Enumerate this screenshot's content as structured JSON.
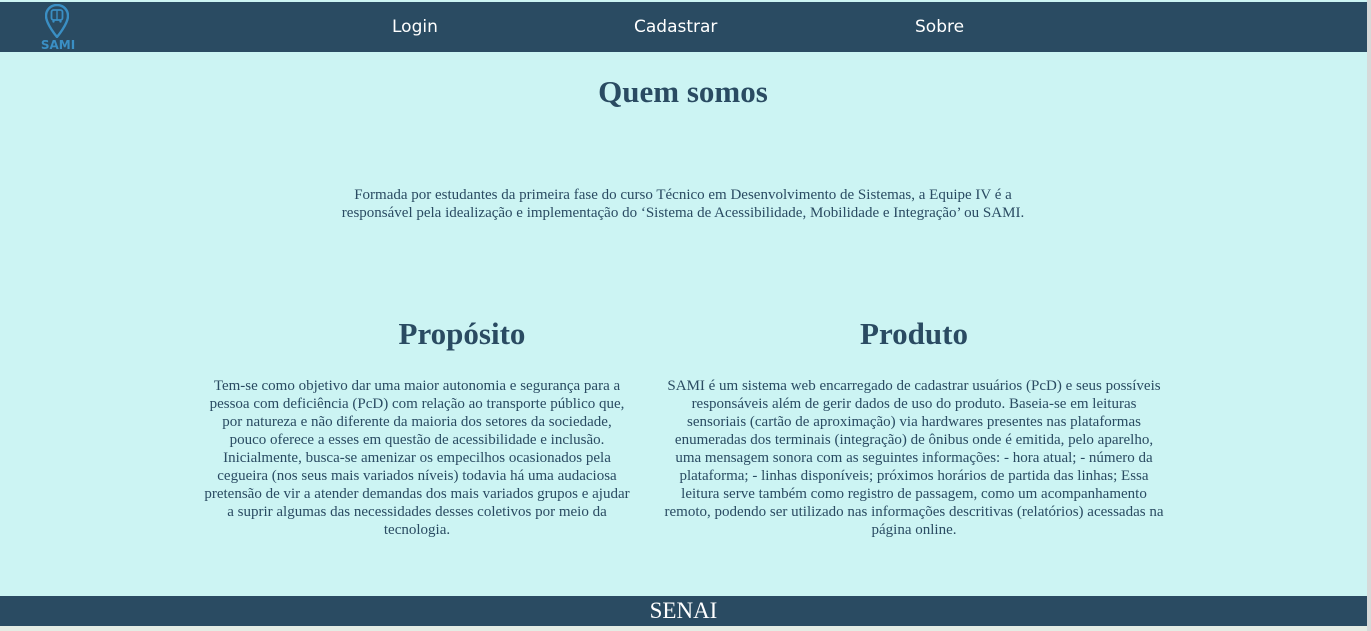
{
  "header": {
    "logo_text": "SAMI",
    "logo_icon": "map-pin-bus-icon",
    "nav": {
      "login": "Login",
      "cadastrar": "Cadastrar",
      "sobre": "Sobre"
    }
  },
  "main": {
    "title": "Quem somos",
    "intro": "Formada por estudantes da primeira fase do curso Técnico em Desenvolvimento de Sistemas, a Equipe IV é a responsável pela idealização e implementação do ‘Sistema de Acessibilidade, Mobilidade e Integração’ ou SAMI.",
    "proposito": {
      "title": "Propósito",
      "text": "Tem-se como objetivo dar uma maior autonomia e segurança para a pessoa com deficiência (PcD) com relação ao transporte público que, por natureza e não diferente da maioria dos setores da sociedade, pouco oferece a esses em questão de acessibilidade e inclusão. Inicialmente, busca-se amenizar os empecilhos ocasionados pela cegueira (nos seus mais variados níveis) todavia há uma audaciosa pretensão de vir a atender demandas dos mais variados grupos e ajudar a suprir algumas das necessidades desses coletivos por meio da tecnologia."
    },
    "produto": {
      "title": "Produto",
      "text": "SAMI é um sistema web encarregado de cadastrar usuários (PcD) e seus possíveis responsáveis além de gerir dados de uso do produto. Baseia-se em leituras sensoriais (cartão de aproximação) via hardwares presentes nas plataformas enumeradas dos terminais (integração) de ônibus onde é emitida, pelo aparelho, uma mensagem sonora com as seguintes informações: - hora atual; - número da plataforma; - linhas disponíveis; próximos horários de partida das linhas; Essa leitura serve também como registro de passagem, como um acompanhamento remoto, podendo ser utilizado nas informações descritivas (relatórios) acessadas na página online."
    }
  },
  "footer": {
    "text": "SENAI"
  },
  "colors": {
    "header_bg": "#2a4b62",
    "page_bg": "#ccf4f3",
    "text": "#2a4b62",
    "logo": "#3a8fc4"
  }
}
